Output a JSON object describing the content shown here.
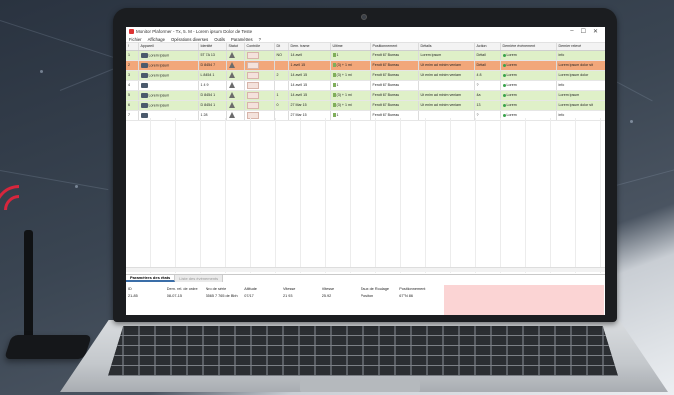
{
  "window": {
    "title": "Monitor Plaformer - Tx, 5. M - Lorem ipsum Dolor de Teste",
    "menu": [
      "Fichier",
      "Affichage",
      "Opérations diverses",
      "Outils",
      "Paramètres",
      "?"
    ],
    "controls": [
      "–",
      "☐",
      "✕"
    ]
  },
  "grid": {
    "columns": [
      "!",
      "Appareil",
      "Identité",
      "Statut",
      "Contrôle",
      "Dt",
      "Dern. trame",
      "Ultime",
      "Positionnement",
      "Détails",
      "Action",
      "Dernière évènement",
      "Dernier relevé"
    ],
    "rows": [
      {
        "style": "green",
        "idx": "1",
        "device": "Lorem ipsum",
        "id": "5T 7A 13",
        "dt": "NO",
        "trame": "14 avril",
        "ultime": "1",
        "pos": "Fendt 67 Bureau",
        "details": "Lorem ipsum",
        "action": "Détail",
        "event": "Lorem",
        "last": "info"
      },
      {
        "style": "orange",
        "idx": "2",
        "device": "Lorem ipsum",
        "id": "D 8454 7",
        "dt": "",
        "trame": "1 avril 15",
        "ultime": "(3) + 1 mi",
        "pos": "Fendt 67 Bureau",
        "details": "Ut enim ad minim veniam",
        "action": "Détail",
        "event": "Lorem",
        "last": "Lorem ipsum dolor sit"
      },
      {
        "style": "green",
        "idx": "3",
        "device": "Lorem ipsum",
        "id": "L 8454 1",
        "dt": "2",
        "trame": "14 avril 15",
        "ultime": "(3) + 1 mi",
        "pos": "Fendt 67 Bureau",
        "details": "Ut enim ad minim veniam",
        "action": "4 8",
        "event": "Lorem",
        "last": "Lorem ipsum dolor"
      },
      {
        "style": "white",
        "idx": "4",
        "device": "",
        "id": "1 4 9",
        "dt": "",
        "trame": "14 avril 15",
        "ultime": "1",
        "pos": "Fendt 67 Bureau",
        "details": "",
        "action": "?",
        "event": "Lorem",
        "last": "info"
      },
      {
        "style": "green",
        "idx": "5",
        "device": "Lorem ipsum",
        "id": "D 8454 1",
        "dt": "1",
        "trame": "14 avril 15",
        "ultime": "(3) + 1 mi",
        "pos": "Fendt 67 Bureau",
        "details": "Ut enim ad minim veniam",
        "action": "4a",
        "event": "Lorem",
        "last": "Lorem ipsum"
      },
      {
        "style": "green",
        "idx": "6",
        "device": "Lorem ipsum",
        "id": "D 8454 1",
        "dt": "0",
        "trame": "27 Mar 15",
        "ultime": "(3) + 1 mi",
        "pos": "Fendt 67 Bureau",
        "details": "Ut enim ad minim veniam",
        "action": "13",
        "event": "Lorem",
        "last": "Lorem ipsum dolor sit"
      },
      {
        "style": "white",
        "idx": "7",
        "device": "",
        "id": "1 28",
        "dt": "",
        "trame": "27 Mar 15",
        "ultime": "1",
        "pos": "Fendt 67 Bureau",
        "details": "",
        "action": "?",
        "event": "Lorem",
        "last": "info"
      }
    ]
  },
  "bottom_panel": {
    "tabs": [
      "Paramètres des états",
      "Liste des évènements"
    ],
    "headers": [
      "ID",
      "Dern. rel. de ordre",
      "Nro de série",
      "Altitude",
      "Vitesse",
      "Vitesse",
      "Taux de Roulage",
      "Positionnement"
    ],
    "values": [
      "21-85",
      "08-07-15",
      "3565 7 765 de Bbh",
      "07/17",
      "21 93",
      "25.92",
      "Positon",
      "67°N 86"
    ]
  }
}
